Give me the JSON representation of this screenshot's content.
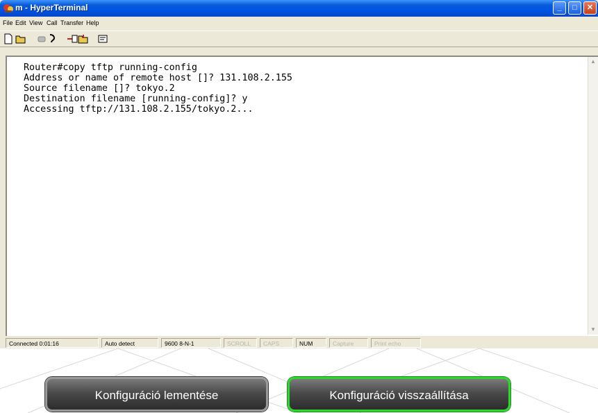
{
  "window": {
    "title": "m - HyperTerminal",
    "icon": "hyperterminal-icon",
    "caption_buttons": [
      "minimize-icon",
      "maximize-icon",
      "close-icon"
    ]
  },
  "menu": {
    "items": [
      "File",
      "Edit",
      "View",
      "Call",
      "Transfer",
      "Help"
    ]
  },
  "toolbar": {
    "icons": [
      "new-icon",
      "open-icon",
      "disconnect-icon",
      "connect-icon",
      "send-icon",
      "receive-icon",
      "properties-icon"
    ]
  },
  "terminal": {
    "lines": [
      "Router#copy tftp running-config",
      "Address or name of remote host []? 131.108.2.155",
      "Source filename []? tokyo.2",
      "Destination filename [running-config]? y",
      "Accessing tftp://131.108.2.155/tokyo.2..."
    ]
  },
  "status": {
    "connected": "Connected 0:01:16",
    "detect": "Auto detect",
    "settings": "9600 8-N-1",
    "scroll": "SCROLL",
    "caps": "CAPS",
    "num": "NUM",
    "capture": "Capture",
    "print_echo": "Print echo"
  },
  "buttons": {
    "save_label": "Konfiguráció lementése",
    "restore_label": "Konfiguráció visszaállítása"
  },
  "colors": {
    "titlebar": "#0055e5",
    "window_face": "#ece9d8",
    "restore_border": "#2ed62e"
  }
}
